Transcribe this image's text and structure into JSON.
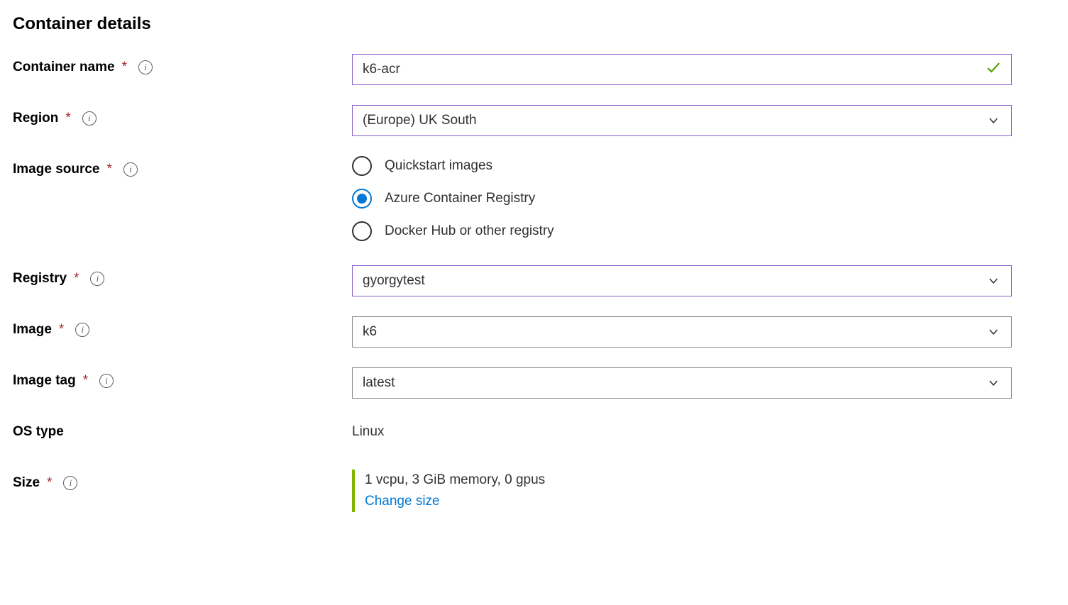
{
  "section_title": "Container details",
  "fields": {
    "container_name": {
      "label": "Container name",
      "value": "k6-acr"
    },
    "region": {
      "label": "Region",
      "value": "(Europe) UK South"
    },
    "image_source": {
      "label": "Image source",
      "options": {
        "quickstart": "Quickstart images",
        "acr": "Azure Container Registry",
        "docker": "Docker Hub or other registry"
      },
      "selected": "acr"
    },
    "registry": {
      "label": "Registry",
      "value": "gyorgytest"
    },
    "image": {
      "label": "Image",
      "value": "k6"
    },
    "image_tag": {
      "label": "Image tag",
      "value": "latest"
    },
    "os_type": {
      "label": "OS type",
      "value": "Linux"
    },
    "size": {
      "label": "Size",
      "summary": "1 vcpu, 3 GiB memory, 0 gpus",
      "change_link": "Change size"
    }
  },
  "glyphs": {
    "required": "*",
    "info": "i"
  }
}
